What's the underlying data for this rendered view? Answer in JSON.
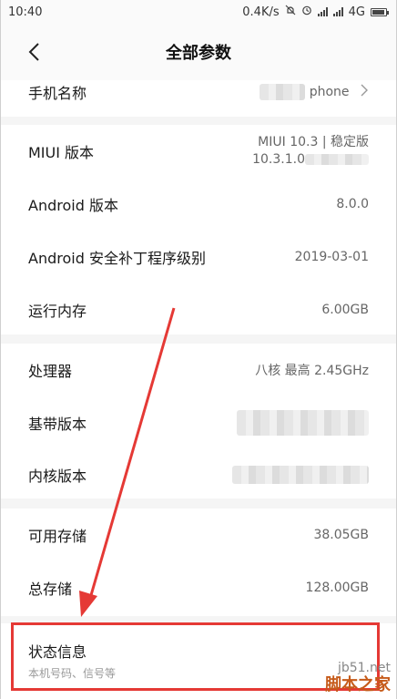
{
  "status_bar": {
    "time": "10:40",
    "net_speed": "0.4K/s",
    "network": "4G",
    "icons": [
      "mute-icon",
      "alarm-icon",
      "signal-icon",
      "signal-icon",
      "battery-icon"
    ],
    "battery_level": 0.8
  },
  "nav": {
    "title": "全部参数",
    "back_icon": "chevron-left-icon"
  },
  "device_name": {
    "label": "手机名称",
    "value": "phone"
  },
  "group1": [
    {
      "label": "MIUI 版本",
      "value_line1": "MIUI 10.3 | 稳定版",
      "value_line2": "10.3.1.0"
    },
    {
      "label": "Android 版本",
      "value": "8.0.0"
    },
    {
      "label": "Android 安全补丁程序级别",
      "value": "2019-03-01"
    },
    {
      "label": "运行内存",
      "value": "6.00GB"
    }
  ],
  "group2": [
    {
      "label": "处理器",
      "value": "八核 最高 2.45GHz"
    },
    {
      "label": "基带版本",
      "value": ""
    },
    {
      "label": "内核版本",
      "value": ""
    }
  ],
  "group3": [
    {
      "label": "可用存储",
      "value": "38.05GB"
    },
    {
      "label": "总存储",
      "value": "128.00GB"
    }
  ],
  "status_info": {
    "label": "状态信息",
    "subtitle": "本机号码、信号等"
  },
  "watermark": {
    "site": "jb51.net",
    "brand": "脚本之家"
  },
  "colors": {
    "highlight": "#e53935",
    "background": "#f5f5f5"
  }
}
